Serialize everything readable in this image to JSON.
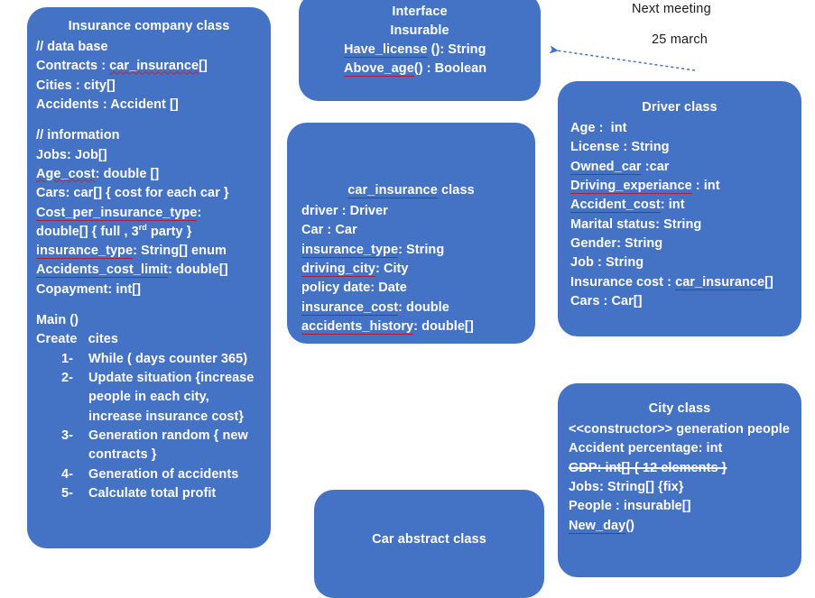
{
  "diagram": {
    "title": "UML class diagram - car insurance system",
    "accent_color": "#4472C4",
    "box_text_color": "#FFFFFF",
    "spellcheck_underline_color": "#C0223B",
    "note_text_color": "#1B1B1B",
    "connector_color": "#4472C4"
  },
  "notes": {
    "next_meeting_label": "Next meeting",
    "next_meeting_date": "25 march"
  },
  "boxes": {
    "insurance_company": {
      "title": "Insurance company class",
      "lines": [
        "// data base",
        "Contracts : car_insurance[]",
        "Cities : city[]",
        "Accidents : Accident []",
        "",
        "// information",
        "Jobs: Job[]",
        "Age_cost: double []",
        "Cars: car[] { cost for each car }",
        "Cost_per_insurance_type:",
        "double[] { full , 3rd party }",
        "insurance_type: String[] enum",
        "Accidents_cost_limit: double[]",
        "Copayment: int[]",
        "",
        "Main ()",
        "Create   cites"
      ],
      "steps": [
        {
          "num": "1-",
          "text": "While ( days counter 365)"
        },
        {
          "num": "2-",
          "text": "Update situation {increase people in each city, increase insurance cost}"
        },
        {
          "num": "3-",
          "text": "Generation random { new contracts }"
        },
        {
          "num": "4-",
          "text": "Generation of accidents"
        },
        {
          "num": "5-",
          "text": "Calculate total profit"
        }
      ]
    },
    "insurable_interface": {
      "title": "Interface",
      "subtitle": "Insurable",
      "lines": [
        "Have_license (): String",
        "Above_age() : Boolean"
      ]
    },
    "car_insurance": {
      "title": "car_insurance class",
      "lines": [
        "driver : Driver",
        "Car : Car",
        "insurance_type: String",
        "driving_city: City",
        "policy date: Date",
        "insurance_cost: double",
        "accidents_history: double[]"
      ]
    },
    "driver": {
      "title": "Driver class",
      "lines": [
        "Age :  int",
        "License : String",
        "Owned_car :car",
        "Driving_experiance : int",
        "Accident_cost: int",
        "Marital status: String",
        "Gender: String",
        "Job : String",
        "Insurance cost : car_insurance[]",
        "Cars : Car[]"
      ]
    },
    "city": {
      "title": "City class",
      "lines": [
        "<<constructor>> generation people",
        "Accident percentage: int",
        "GDP: int[] { 12 elements }",
        "Jobs: String[] {fix}",
        "People : insurable[]",
        "New_day()"
      ]
    },
    "car_abstract": {
      "title": "Car abstract class"
    }
  }
}
